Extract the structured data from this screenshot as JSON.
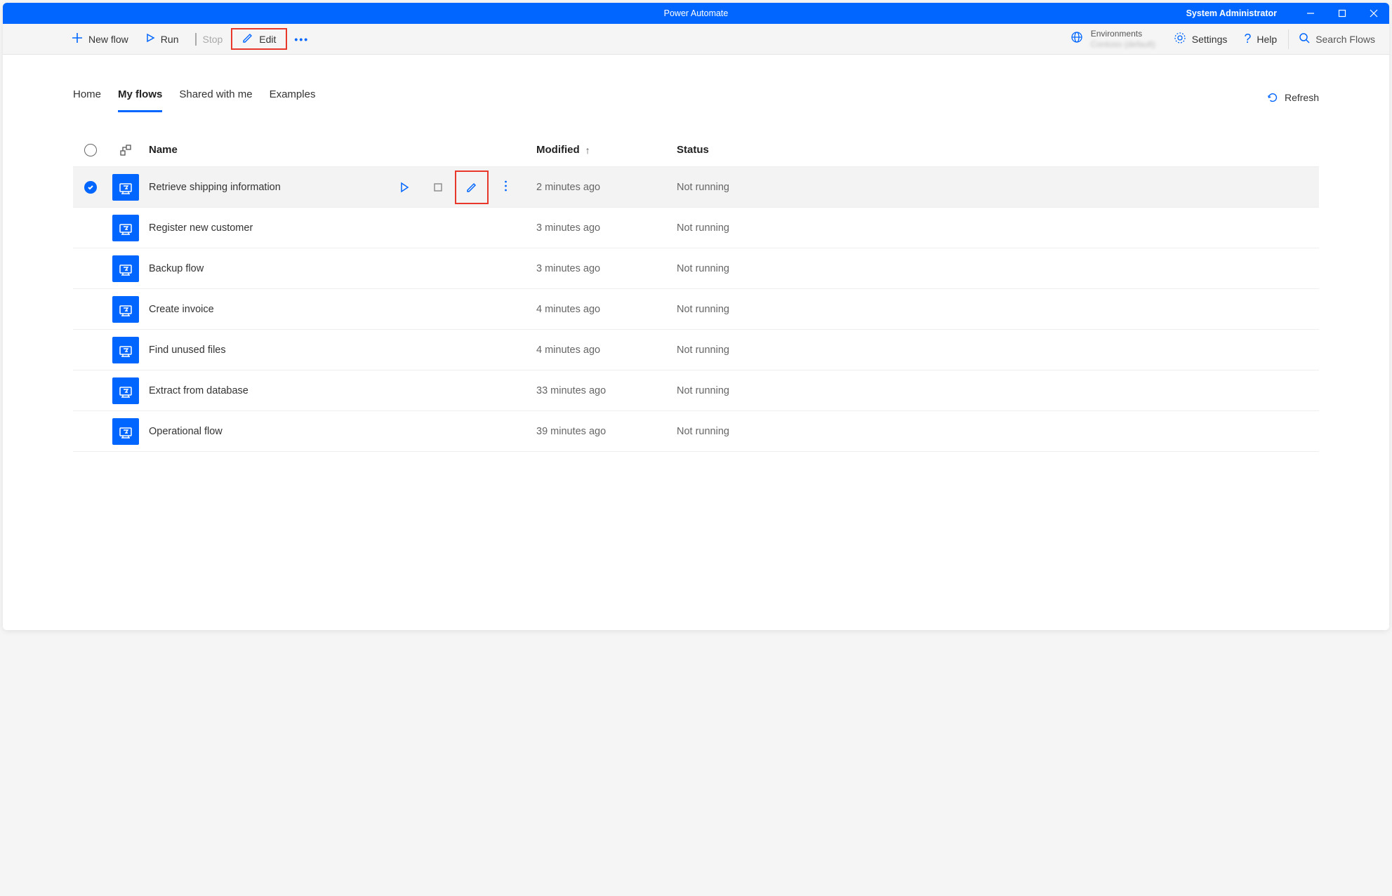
{
  "window": {
    "title": "Power Automate",
    "user": "System Administrator"
  },
  "toolbar": {
    "new_flow": "New flow",
    "run": "Run",
    "stop": "Stop",
    "edit": "Edit",
    "environments_label": "Environments",
    "environments_value": "Contoso (default)",
    "settings": "Settings",
    "help": "Help",
    "search_placeholder": "Search Flows"
  },
  "tabs": {
    "home": "Home",
    "my_flows": "My flows",
    "shared": "Shared with me",
    "examples": "Examples",
    "refresh": "Refresh"
  },
  "columns": {
    "name": "Name",
    "modified": "Modified",
    "status": "Status"
  },
  "flows": [
    {
      "name": "Retrieve shipping information",
      "modified": "2 minutes ago",
      "status": "Not running",
      "selected": true
    },
    {
      "name": "Register new customer",
      "modified": "3 minutes ago",
      "status": "Not running",
      "selected": false
    },
    {
      "name": "Backup flow",
      "modified": "3 minutes ago",
      "status": "Not running",
      "selected": false
    },
    {
      "name": "Create invoice",
      "modified": "4 minutes ago",
      "status": "Not running",
      "selected": false
    },
    {
      "name": "Find unused files",
      "modified": "4 minutes ago",
      "status": "Not running",
      "selected": false
    },
    {
      "name": "Extract from database",
      "modified": "33 minutes ago",
      "status": "Not running",
      "selected": false
    },
    {
      "name": "Operational flow",
      "modified": "39 minutes ago",
      "status": "Not running",
      "selected": false
    }
  ]
}
